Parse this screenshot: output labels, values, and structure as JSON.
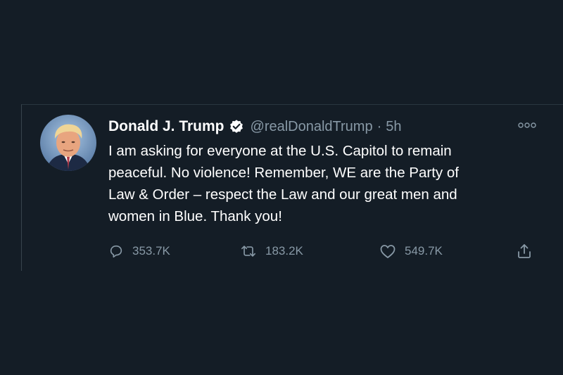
{
  "tweet": {
    "author_name": "Donald J. Trump",
    "handle": "@realDonaldTrump",
    "separator": "·",
    "time": "5h",
    "text_lines": [
      "I am asking for everyone at the U.S. Capitol to remain",
      "peaceful. No violence! Remember, WE are the Party of",
      "Law & Order – respect the Law and our great men and",
      "women in Blue. Thank you!"
    ],
    "replies": "353.7K",
    "retweets": "183.2K",
    "likes": "549.7K"
  },
  "icons": {
    "avatar": "profile-photo",
    "verified": "verified-badge-icon",
    "more": "more-options-icon",
    "reply": "reply-icon",
    "retweet": "retweet-icon",
    "like": "heart-icon",
    "share": "share-icon"
  },
  "colors": {
    "background": "#141d26",
    "text_primary": "#ffffff",
    "text_secondary": "#8899a6"
  }
}
